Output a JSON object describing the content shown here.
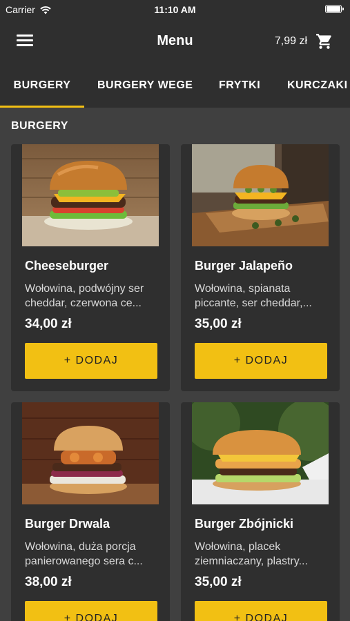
{
  "status_bar": {
    "carrier": "Carrier",
    "time": "11:10 AM"
  },
  "header": {
    "title": "Menu",
    "cart_total": "7,99 zł"
  },
  "tabs": [
    {
      "label": "BURGERY",
      "active": true
    },
    {
      "label": "BURGERY WEGE",
      "active": false
    },
    {
      "label": "FRYTKI",
      "active": false
    },
    {
      "label": "KURCZAKI",
      "active": false
    }
  ],
  "section": {
    "title": "BURGERY"
  },
  "products": [
    {
      "name": "Cheeseburger",
      "desc_line1": "Wołowina, podwójny ser",
      "desc_line2": "cheddar, czerwona ce...",
      "price": "34,00 zł",
      "button": "+ DODAJ"
    },
    {
      "name": "Burger Jalapeño",
      "desc_line1": "Wołowina, spianata",
      "desc_line2": "piccante, ser cheddar,...",
      "price": "35,00 zł",
      "button": "+ DODAJ"
    },
    {
      "name": "Burger Drwala",
      "desc_line1": "Wołowina, duża porcja",
      "desc_line2": "panierowanego sera c...",
      "price": "38,00 zł",
      "button": "+ DODAJ"
    },
    {
      "name": "Burger Zbójnicki",
      "desc_line1": "Wołowina, placek",
      "desc_line2": "ziemniaczany, plastry...",
      "price": "35,00 zł",
      "button": "+ DODAJ"
    }
  ],
  "colors": {
    "background": "#404040",
    "bar": "#2f2f2f",
    "accent": "#f2c013"
  }
}
